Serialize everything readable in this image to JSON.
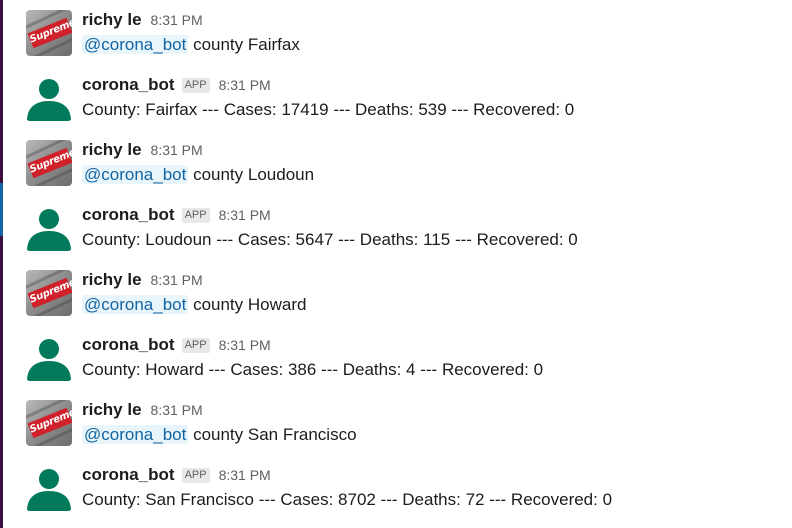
{
  "colors": {
    "mention_text": "#1264a3",
    "mention_bg": "#e8f5fa",
    "bot_avatar": "#007a5a",
    "sidebar": "#3f0e40",
    "sidebar_accent": "#1264a3"
  },
  "messages": [
    {
      "sender": "richy le",
      "time": "8:31 PM",
      "avatar": "supreme-photo-avatar",
      "mention": "@corona_bot",
      "text": "county Fairfax"
    },
    {
      "sender": "corona_bot",
      "badge": "APP",
      "time": "8:31 PM",
      "avatar": "default-user-avatar",
      "text": "County: Fairfax --- Cases: 17419 --- Deaths: 539 --- Recovered: 0"
    },
    {
      "sender": "richy le",
      "time": "8:31 PM",
      "avatar": "supreme-photo-avatar",
      "mention": "@corona_bot",
      "text": "county Loudoun"
    },
    {
      "sender": "corona_bot",
      "badge": "APP",
      "time": "8:31 PM",
      "avatar": "default-user-avatar",
      "text": "County: Loudoun --- Cases: 5647 --- Deaths: 115 --- Recovered: 0"
    },
    {
      "sender": "richy le",
      "time": "8:31 PM",
      "avatar": "supreme-photo-avatar",
      "mention": "@corona_bot",
      "text": "county Howard"
    },
    {
      "sender": "corona_bot",
      "badge": "APP",
      "time": "8:31 PM",
      "avatar": "default-user-avatar",
      "text": "County: Howard --- Cases: 386 --- Deaths: 4 --- Recovered: 0"
    },
    {
      "sender": "richy le",
      "time": "8:31 PM",
      "avatar": "supreme-photo-avatar",
      "mention": "@corona_bot",
      "text": "county San Francisco"
    },
    {
      "sender": "corona_bot",
      "badge": "APP",
      "time": "8:31 PM",
      "avatar": "default-user-avatar",
      "text": "County: San Francisco --- Cases: 8702 --- Deaths: 72 --- Recovered: 0"
    }
  ],
  "avatar_logo_text": "Supreme"
}
